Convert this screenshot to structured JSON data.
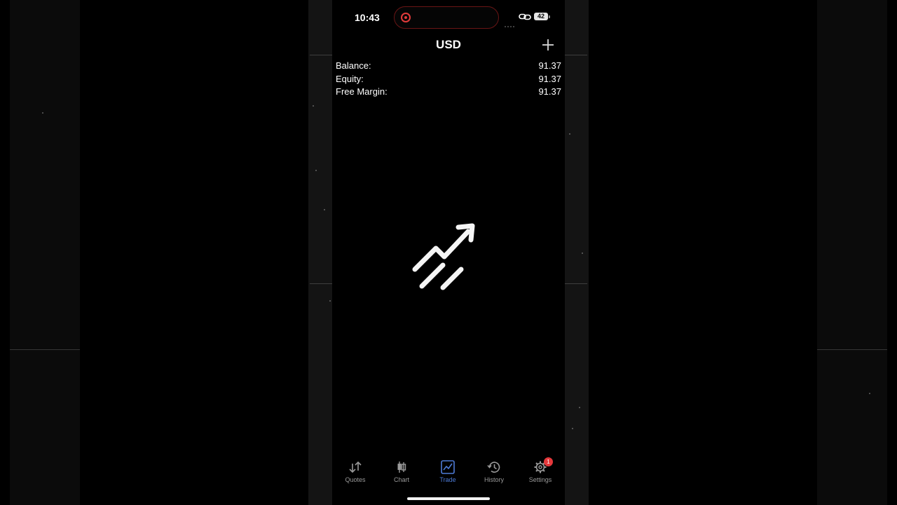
{
  "status_bar": {
    "time": "10:43",
    "battery": "42"
  },
  "header": {
    "title": "USD"
  },
  "account": {
    "rows": [
      {
        "label": "Balance:",
        "value": "91.37"
      },
      {
        "label": "Equity:",
        "value": "91.37"
      },
      {
        "label": "Free Margin:",
        "value": "91.37"
      }
    ]
  },
  "tabbar": {
    "items": [
      {
        "label": "Quotes",
        "icon": "quotes-arrows-icon"
      },
      {
        "label": "Chart",
        "icon": "candlestick-icon"
      },
      {
        "label": "Trade",
        "icon": "trade-chart-icon",
        "active": true
      },
      {
        "label": "History",
        "icon": "history-clock-icon"
      },
      {
        "label": "Settings",
        "icon": "gear-icon",
        "badge": "1"
      }
    ]
  },
  "colors": {
    "background": "#000000",
    "text": "#ffffff",
    "active_tab": "#4d7bd6",
    "inactive_tab": "#9a9a9a",
    "badge": "#e5383b",
    "recording": "#e23b3b"
  }
}
